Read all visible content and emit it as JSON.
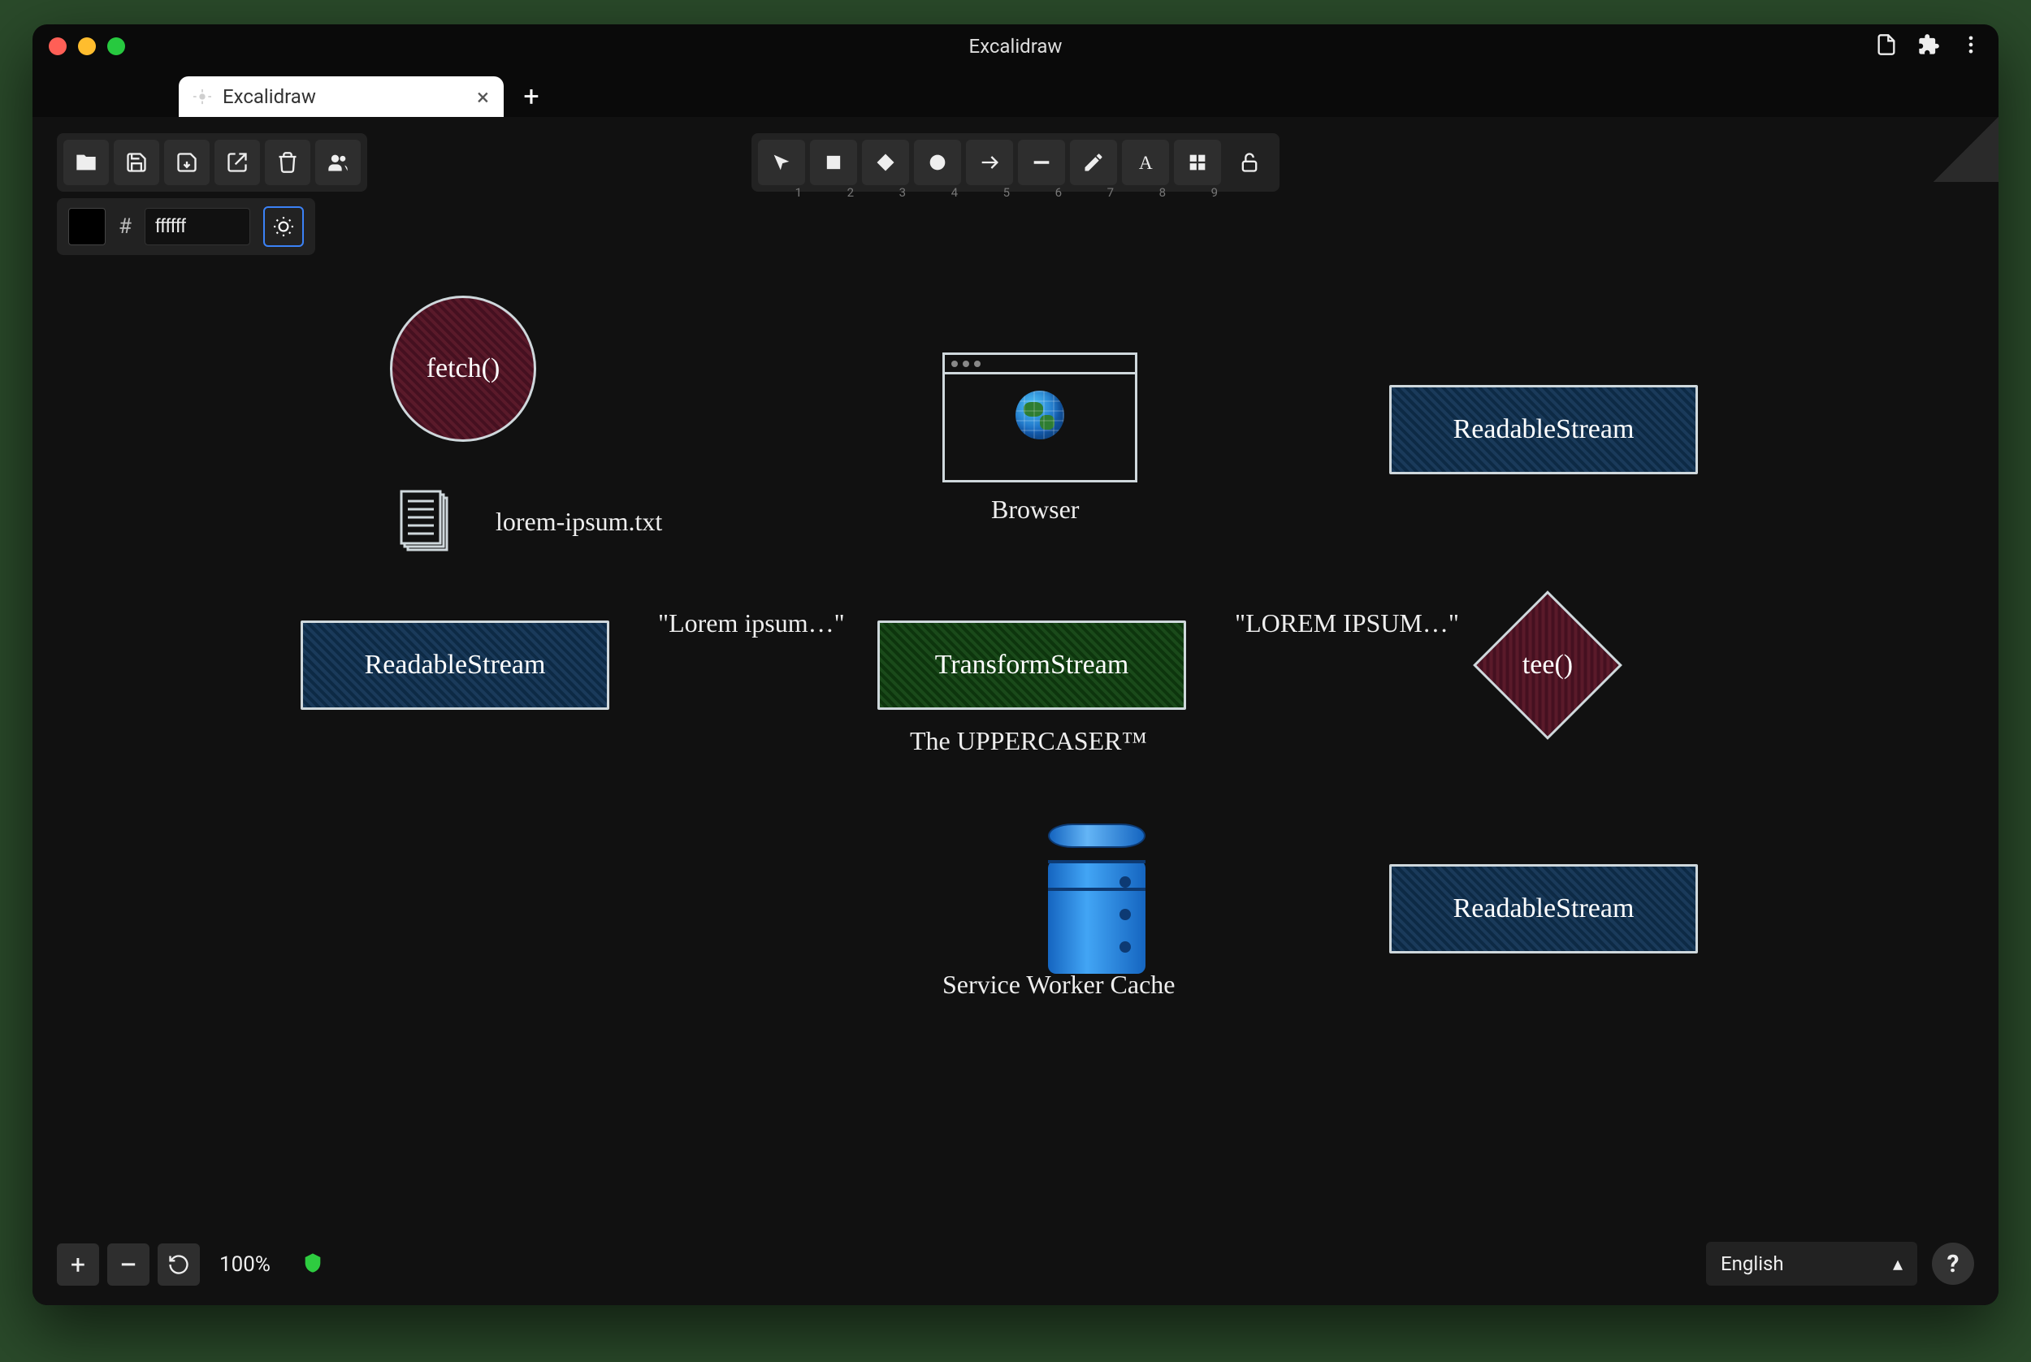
{
  "window": {
    "title": "Excalidraw"
  },
  "tab": {
    "label": "Excalidraw"
  },
  "color": {
    "hex": "ffffff"
  },
  "zoom": {
    "label": "100%"
  },
  "language": {
    "selected": "English"
  },
  "tools": {
    "n1": "1",
    "n2": "2",
    "n3": "3",
    "n4": "4",
    "n5": "5",
    "n6": "6",
    "n7": "7",
    "n8": "8",
    "n9": "9"
  },
  "diagram": {
    "fetch": "fetch()",
    "file_label": "lorem-ipsum.txt",
    "readable1": "ReadableStream",
    "arrow1_label": "\"Lorem ipsum…\"",
    "transform": "TransformStream",
    "transform_caption": "The UPPERCASER™",
    "arrow2_label": "\"LOREM IPSUM…\"",
    "tee": "tee()",
    "readable2": "ReadableStream",
    "browser_caption": "Browser",
    "readable3": "ReadableStream",
    "cache_caption": "Service Worker Cache"
  }
}
